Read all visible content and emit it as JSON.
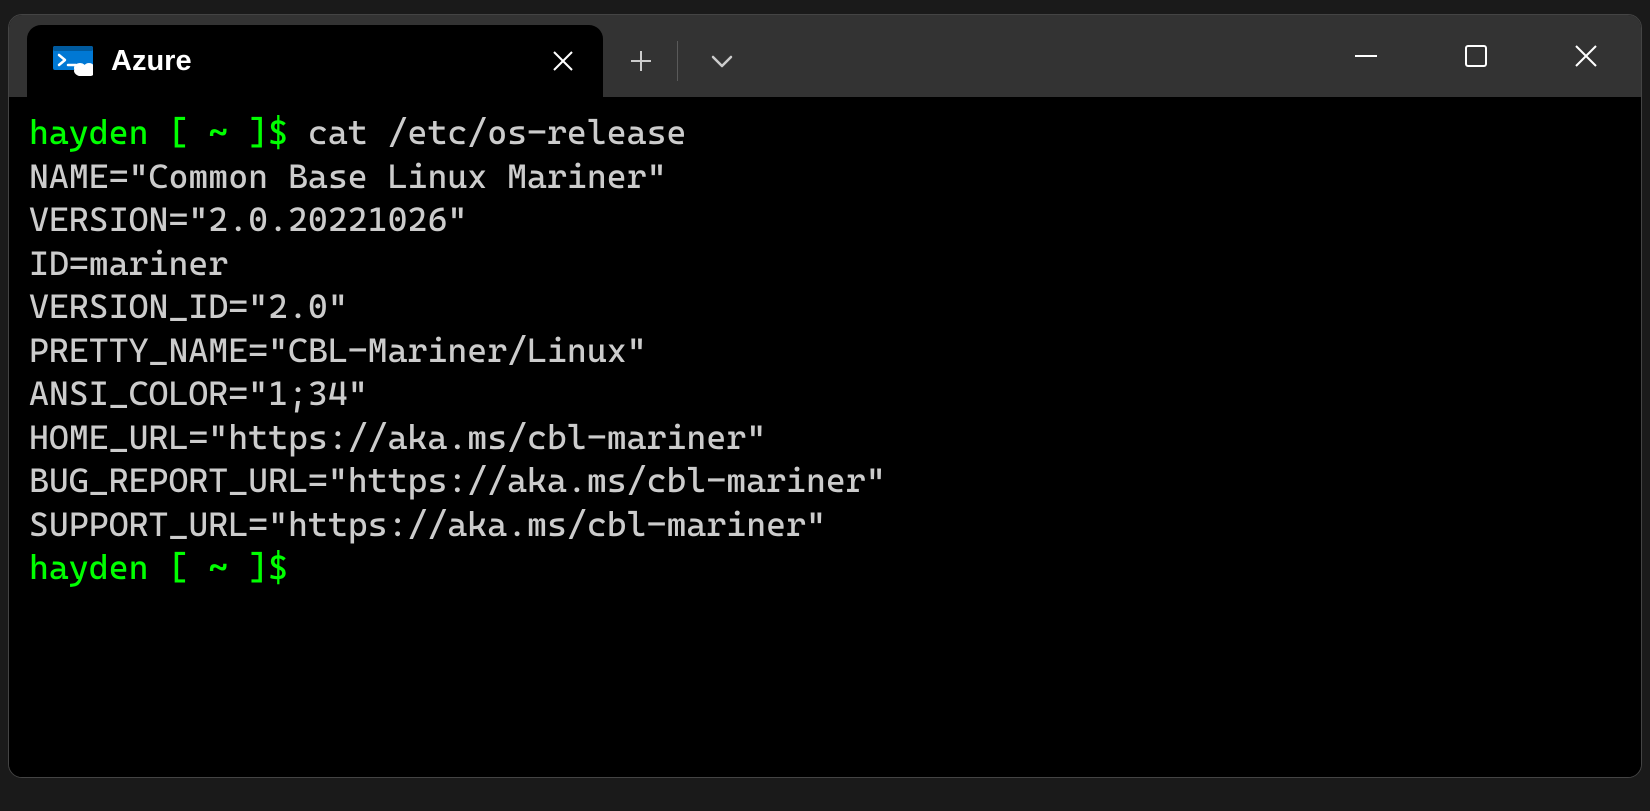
{
  "titlebar": {
    "tab_title": "Azure",
    "tab_icon": "azure-cloud-shell-icon"
  },
  "terminal": {
    "prompt1": "hayden [ ~ ]$ ",
    "command1": "cat /etc/os-release",
    "lines": [
      "NAME=\"Common Base Linux Mariner\"",
      "VERSION=\"2.0.20221026\"",
      "ID=mariner",
      "VERSION_ID=\"2.0\"",
      "PRETTY_NAME=\"CBL-Mariner/Linux\"",
      "ANSI_COLOR=\"1;34\"",
      "HOME_URL=\"https://aka.ms/cbl-mariner\"",
      "BUG_REPORT_URL=\"https://aka.ms/cbl-mariner\"",
      "SUPPORT_URL=\"https://aka.ms/cbl-mariner\""
    ],
    "prompt2": "hayden [ ~ ]$ "
  }
}
